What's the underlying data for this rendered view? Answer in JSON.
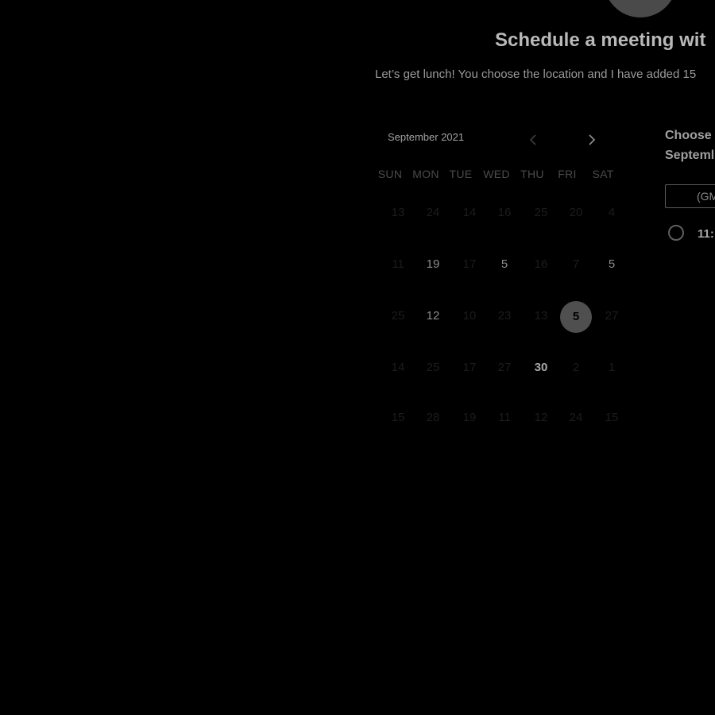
{
  "header": {
    "title": "Schedule a meeting wit",
    "description": "Let’s get lunch! You choose the location and I have added 15"
  },
  "calendar": {
    "month_label": "September 2021",
    "prev_icon": "chevron-left-icon",
    "next_icon": "chevron-right-icon",
    "weekdays": [
      "SUN",
      "MON",
      "TUE",
      "WED",
      "THU",
      "FRI",
      "SAT"
    ],
    "weeks": [
      [
        "13",
        "24",
        "14",
        "16",
        "25",
        "20",
        "4"
      ],
      [
        "11",
        "19",
        "17",
        "5",
        "16",
        "7",
        "5"
      ],
      [
        "25",
        "12",
        "10",
        "23",
        "13",
        "5",
        "27"
      ],
      [
        "14",
        "25",
        "17",
        "27",
        "30",
        "2",
        "1"
      ],
      [
        "15",
        "28",
        "19",
        "11",
        "12",
        "24",
        "15"
      ]
    ],
    "selected_date": "5"
  },
  "time_panel": {
    "heading_line1": "Choose",
    "heading_line2": "Septeml",
    "timezone_text": "(GM",
    "slot_time": "11:"
  },
  "colors": {
    "background": "#000000",
    "selected_day_bg": "#4f4f4f"
  }
}
